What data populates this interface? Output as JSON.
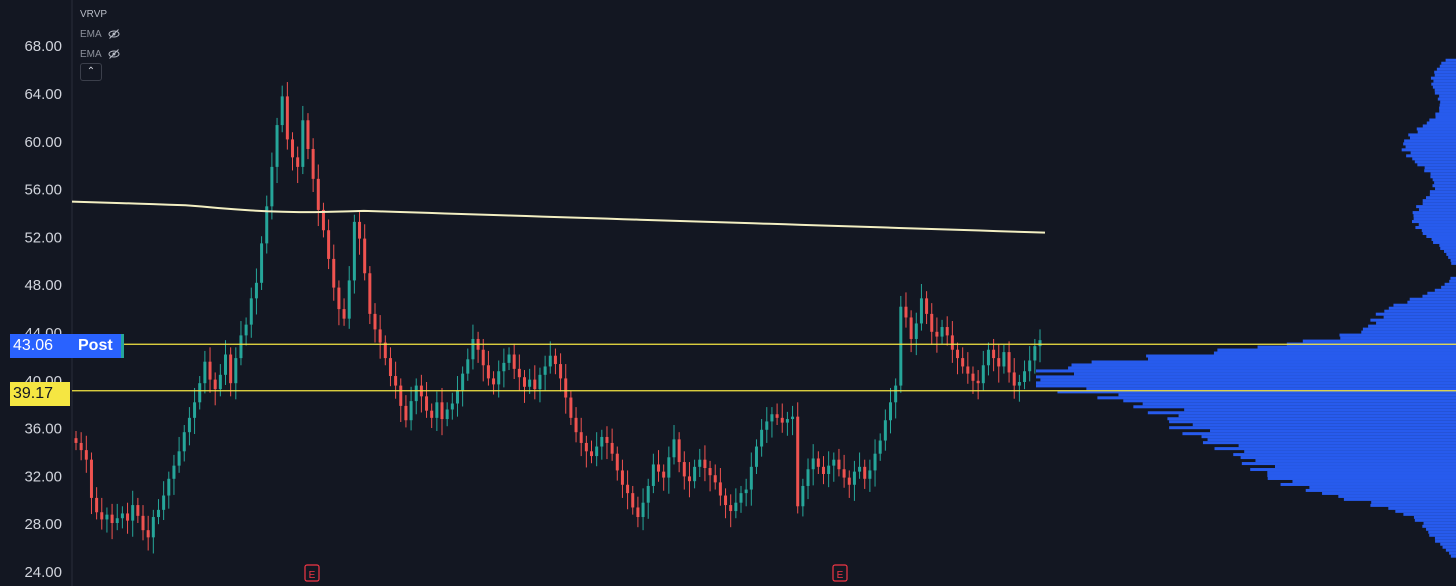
{
  "chart_data": {
    "type": "candlestick",
    "ylim": [
      24,
      72
    ],
    "y_ticks": [
      "24.00",
      "28.00",
      "32.00",
      "36.00",
      "40.00",
      "44.00",
      "48.00",
      "52.00",
      "56.00",
      "60.00",
      "64.00",
      "68.00"
    ],
    "indicators": [
      "VRVP",
      "EMA",
      "EMA"
    ],
    "ema_line": {
      "color": "#f3efc2",
      "values_start_end": [
        55.0,
        52.4
      ]
    },
    "horizontal_lines": [
      {
        "value": 43.06,
        "label": "43.06",
        "color": "#f5e642"
      },
      {
        "value": 39.17,
        "label": "39.17",
        "color": "#f5e642"
      }
    ],
    "post_label": "Post",
    "earnings_markers": [
      "E",
      "E"
    ],
    "candle_closes": [
      34.8,
      34.2,
      33.4,
      30.2,
      29.0,
      28.4,
      28.8,
      28.1,
      28.5,
      28.9,
      28.3,
      29.6,
      28.7,
      27.5,
      26.9,
      28.6,
      29.2,
      30.4,
      31.8,
      32.9,
      34.1,
      35.7,
      36.9,
      38.2,
      39.8,
      41.6,
      40.1,
      39.3,
      40.5,
      42.2,
      39.8,
      41.9,
      43.8,
      44.7,
      46.9,
      48.2,
      51.5,
      54.6,
      57.9,
      61.4,
      63.8,
      60.2,
      58.7,
      57.9,
      61.8,
      59.4,
      56.9,
      54.3,
      52.6,
      50.2,
      47.8,
      46.0,
      45.2,
      48.4,
      53.3,
      51.9,
      49.0,
      45.6,
      44.3,
      43.2,
      41.9,
      40.4,
      39.6,
      37.9,
      36.7,
      38.3,
      39.6,
      38.7,
      37.5,
      36.9,
      38.2,
      36.8,
      37.6,
      38.1,
      39.2,
      40.6,
      41.8,
      43.5,
      42.6,
      41.3,
      40.2,
      39.7,
      40.8,
      41.5,
      42.2,
      41.0,
      40.3,
      39.5,
      40.1,
      39.3,
      40.5,
      41.2,
      42.1,
      41.4,
      40.2,
      38.6,
      36.9,
      35.7,
      34.8,
      34.1,
      33.7,
      34.5,
      35.3,
      34.8,
      33.9,
      32.5,
      31.3,
      30.6,
      29.4,
      28.6,
      29.8,
      31.2,
      33.0,
      32.4,
      31.9,
      33.6,
      35.1,
      33.2,
      32.0,
      31.6,
      32.8,
      33.4,
      32.7,
      32.1,
      31.5,
      30.4,
      29.6,
      29.1,
      29.8,
      30.6,
      30.9,
      32.8,
      34.5,
      35.9,
      36.6,
      37.2,
      36.9,
      36.5,
      36.8,
      37.0,
      29.5,
      31.2,
      32.6,
      33.5,
      32.8,
      32.2,
      32.9,
      33.4,
      32.6,
      31.9,
      31.3,
      32.4,
      32.8,
      31.8,
      32.5,
      33.9,
      35.0,
      36.7,
      38.2,
      39.6,
      46.2,
      45.3,
      43.5,
      44.8,
      46.9,
      45.6,
      44.1,
      43.7,
      44.5,
      43.8,
      42.6,
      41.9,
      41.2,
      40.6,
      40.0,
      39.8,
      41.3,
      42.6,
      41.9,
      41.2,
      42.4,
      40.7,
      39.6,
      39.9,
      40.8,
      41.7,
      42.9,
      43.4
    ],
    "volume_profile": "right-aligned horizontal histogram, peak near 39-43"
  },
  "legend": {
    "row1": "VRVP",
    "row2": "EMA",
    "row3": "EMA",
    "collapse_icon": "chevron-up-icon"
  },
  "tags": {
    "post_price": "43.06",
    "post_label": "Post",
    "yellow_price": "39.17"
  },
  "colors": {
    "background": "#131722",
    "up": "#26a69a",
    "down": "#ef5350",
    "hline": "#f5e642",
    "ema": "#f3efc2",
    "volume_profile": "#2962ff",
    "earnings": "#f23645"
  }
}
